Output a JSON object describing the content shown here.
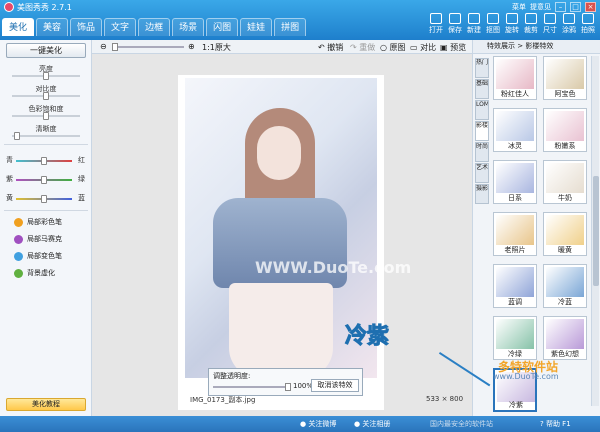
{
  "app": {
    "title": "美图秀秀 2.7.1"
  },
  "tabs": [
    "美化",
    "美容",
    "饰品",
    "文字",
    "边框",
    "场景",
    "闪图",
    "娃娃",
    "拼图"
  ],
  "window_controls": {
    "menu": "菜单",
    "feedback": "提意见"
  },
  "toolbar": [
    {
      "label": "打开",
      "icon": "open-icon"
    },
    {
      "label": "保存",
      "icon": "save-icon"
    },
    {
      "label": "新建",
      "icon": "new-icon"
    },
    {
      "label": "抠图",
      "icon": "cutout-icon"
    },
    {
      "label": "旋转",
      "icon": "rotate-icon"
    },
    {
      "label": "裁剪",
      "icon": "crop-icon"
    },
    {
      "label": "尺寸",
      "icon": "size-icon"
    },
    {
      "label": "涂鸦",
      "icon": "doodle-icon"
    },
    {
      "label": "拍照",
      "icon": "camera-icon"
    }
  ],
  "left": {
    "oneclick": "一键美化",
    "sliders": [
      "亮度",
      "对比度",
      "色彩饱和度",
      "清晰度"
    ],
    "color_sliders": [
      {
        "left": "青",
        "right": "红",
        "color": "#e04040"
      },
      {
        "left": "紫",
        "right": "绿",
        "color": "#40b040"
      },
      {
        "left": "黄",
        "right": "蓝",
        "color": "#4060e0"
      }
    ],
    "brushes": [
      {
        "label": "局部彩色笔",
        "color": "#f0a020"
      },
      {
        "label": "局部马赛克",
        "color": "#a050c0"
      },
      {
        "label": "局部变色笔",
        "color": "#40a0e0"
      },
      {
        "label": "背景虚化",
        "color": "#60b040"
      }
    ],
    "tutorial": "美化教程"
  },
  "canvas": {
    "zoom": "1:1原大",
    "undo": "撤销",
    "redo": "重做",
    "original": "原图",
    "compare": "对比",
    "preview": "预览",
    "watermark": "WWW.DuoTe.com",
    "filename": "IMG_0173_副本.jpg",
    "size": "533 × 800",
    "opacity": {
      "label": "调整透明度:",
      "value": "100%",
      "value_fraction": 1.0,
      "cancel": "取消该特效"
    }
  },
  "right": {
    "breadcrumb": "特效展示 > 影楼特效",
    "vtabs": [
      "热门",
      "基础",
      "LOMO",
      "影楼",
      "时尚",
      "艺术",
      "摄影"
    ],
    "effects": [
      "粉红佳人",
      "阿宝色",
      "冰灵",
      "粉嫩系",
      "日系",
      "牛奶",
      "老照片",
      "暖黄",
      "蓝调",
      "冷蓝",
      "冷绿",
      "紫色幻想",
      "冷紫"
    ]
  },
  "callout": "冷紫",
  "status": {
    "weibo": "关注微博",
    "album": "关注相册",
    "diy": "DIY礼物",
    "help": "帮助 F1"
  },
  "site_watermark": {
    "cn": "多特软件站",
    "url": "www.DuoTe.com",
    "slogan": "国内最安全的软件站"
  }
}
